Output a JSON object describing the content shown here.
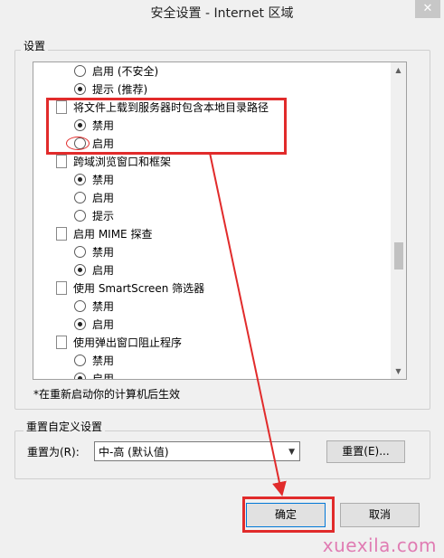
{
  "window": {
    "title": "安全设置 - Internet 区域",
    "close_glyph": "✕"
  },
  "settings": {
    "group_label": "设置",
    "rows": [
      {
        "kind": "radio",
        "label": "启用 (不安全)",
        "checked": false
      },
      {
        "kind": "radio",
        "label": "提示 (推荐)",
        "checked": true
      },
      {
        "kind": "header",
        "label": "将文件上载到服务器时包含本地目录路径",
        "icon": "page-icon"
      },
      {
        "kind": "radio",
        "label": "禁用",
        "checked": true
      },
      {
        "kind": "radio",
        "label": "启用",
        "checked": false
      },
      {
        "kind": "header",
        "label": "跨域浏览窗口和框架",
        "icon": "page-icon"
      },
      {
        "kind": "radio",
        "label": "禁用",
        "checked": true
      },
      {
        "kind": "radio",
        "label": "启用",
        "checked": false
      },
      {
        "kind": "radio",
        "label": "提示",
        "checked": false
      },
      {
        "kind": "header",
        "label": "启用 MIME 探查",
        "icon": "page-icon"
      },
      {
        "kind": "radio",
        "label": "禁用",
        "checked": false
      },
      {
        "kind": "radio",
        "label": "启用",
        "checked": true
      },
      {
        "kind": "header",
        "label": "使用 SmartScreen 筛选器",
        "icon": "page-icon"
      },
      {
        "kind": "radio",
        "label": "禁用",
        "checked": false
      },
      {
        "kind": "radio",
        "label": "启用",
        "checked": true
      },
      {
        "kind": "header",
        "label": "使用弹出窗口阻止程序",
        "icon": "page-icon"
      },
      {
        "kind": "radio",
        "label": "禁用",
        "checked": false
      },
      {
        "kind": "radio",
        "label": "启用",
        "checked": true
      }
    ],
    "note": "*在重新启动你的计算机后生效"
  },
  "reset": {
    "group_label": "重置自定义设置",
    "reset_to_label": "重置为(R):",
    "selected_level": "中-高 (默认值)",
    "reset_button": "重置(E)..."
  },
  "footer": {
    "ok_button": "确定",
    "cancel_button": "取消"
  },
  "watermark": "xuexila.com",
  "colors": {
    "highlight_red": "#e12b2b",
    "watermark_pink": "#e07cb3"
  }
}
